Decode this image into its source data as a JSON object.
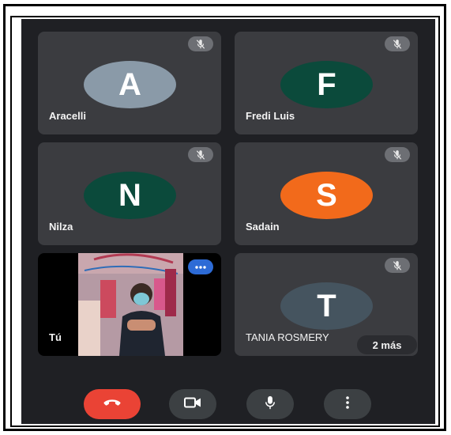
{
  "participants": [
    {
      "initial": "A",
      "name": "Aracelli",
      "color": "#8a9aa8"
    },
    {
      "initial": "F",
      "name": "Fredi Luis",
      "color": "#0b4a3b"
    },
    {
      "initial": "N",
      "name": "Nilza",
      "color": "#0b4a3b"
    },
    {
      "initial": "S",
      "name": "Sadain",
      "color": "#f26a1b"
    },
    {
      "initial": "T",
      "name": "TANIA ROSMERY",
      "color": "#45545f"
    }
  ],
  "self": {
    "name": "Tú"
  },
  "more_participants": "2 más",
  "controls": {
    "end_call_color": "#ea4335",
    "button_color": "#3c4043",
    "icons": [
      "hang-up-icon",
      "camera-icon",
      "microphone-icon",
      "more-options-icon"
    ]
  }
}
